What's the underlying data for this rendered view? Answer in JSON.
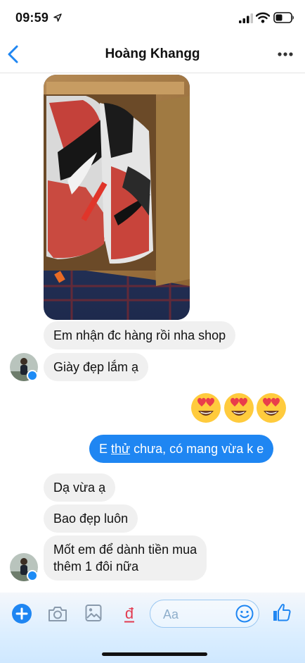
{
  "status_bar": {
    "time": "09:59"
  },
  "header": {
    "contact_name": "Hoàng Khangg"
  },
  "messages": {
    "m1": "Em nhận đc hàng rồi nha shop",
    "m2": "Giày đẹp lắm ạ",
    "m3_pre": "E ",
    "m3_u": "thử",
    "m3_post": " chưa, có mang vừa k e",
    "m4": "Dạ vừa ạ",
    "m5": "Bao đẹp luôn",
    "m6_line1": "Mốt em để dành tiền mua",
    "m6_line2": "thêm 1 đôi nữa"
  },
  "composer": {
    "placeholder": "Aa"
  },
  "colors": {
    "accent": "#1f86f2",
    "incoming_bubble": "#f0f0f0",
    "badge": "#1d8bf5"
  },
  "icons": [
    "location-arrow-icon",
    "signal-icon",
    "wifi-icon",
    "battery-icon",
    "back-chevron-icon",
    "more-dots-icon",
    "plus-icon",
    "camera-icon",
    "image-icon",
    "dong-currency-icon",
    "emoji-icon",
    "thumbs-up-icon",
    "heart-eyes-emoji"
  ]
}
